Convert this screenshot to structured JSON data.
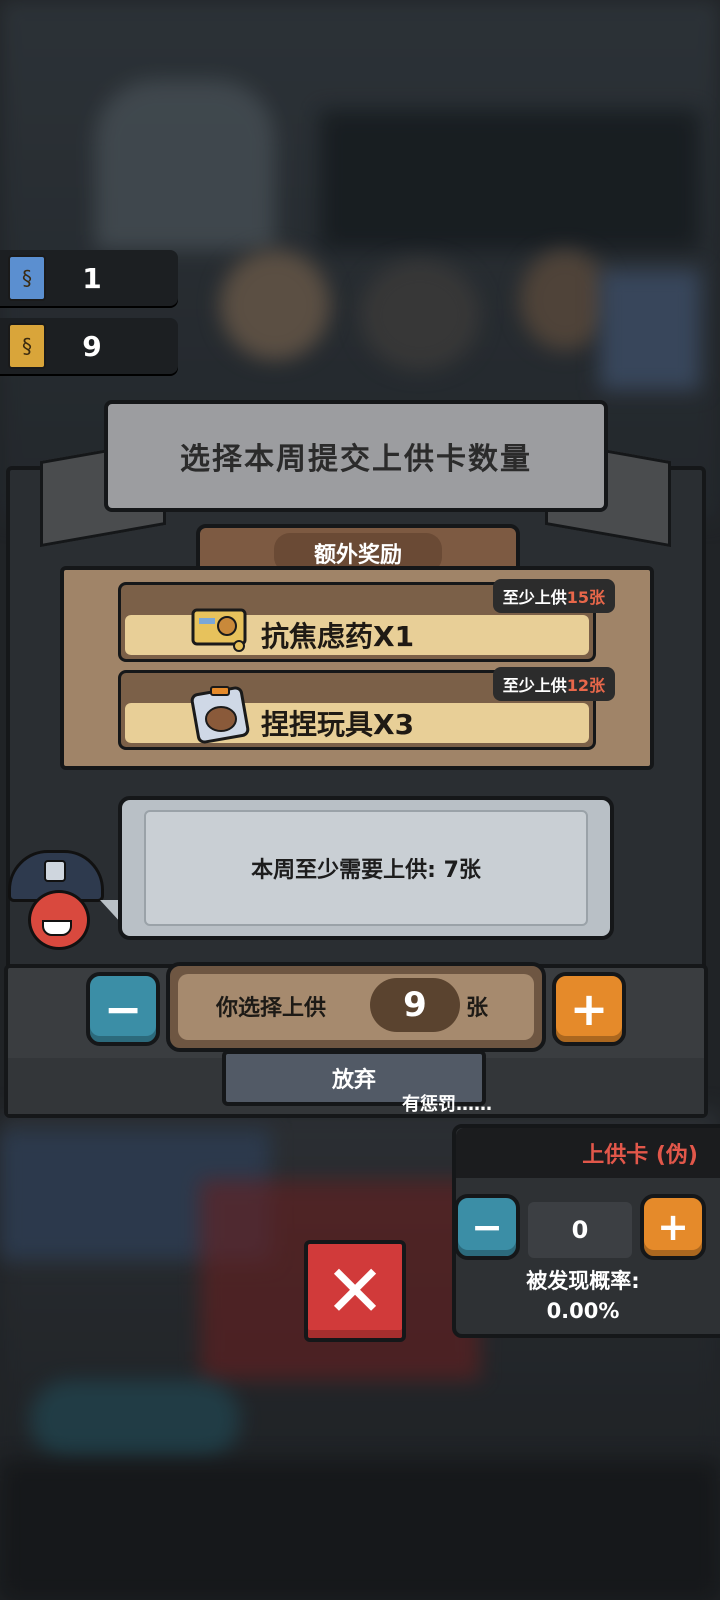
{
  "currency": {
    "real_cards": {
      "value": "1",
      "icon": "blue-card-icon",
      "color": "#5b8fd0"
    },
    "gold_cards": {
      "value": "9",
      "icon": "gold-card-icon",
      "color": "#d9a53a"
    }
  },
  "dialog": {
    "title": "选择本周提交上供卡数量",
    "rewards_title": "额外奖励",
    "rewards": [
      {
        "name": "抗焦虑药X1",
        "icon": "medicine-pack-icon",
        "requirement_prefix": "至少上供",
        "requirement_count": "15张"
      },
      {
        "name": "捏捏玩具X3",
        "icon": "squeeze-toy-icon",
        "requirement_prefix": "至少上供",
        "requirement_count": "12张"
      }
    ],
    "speech": "本周至少需要上供: 7张",
    "selector": {
      "prefix": "你选择上供",
      "value": "9",
      "suffix": "张",
      "minus": "−",
      "plus": "+"
    },
    "give_up": {
      "label": "放弃",
      "note": "有惩罚……"
    }
  },
  "fake_card": {
    "title": "上供卡 (伪)",
    "value": "0",
    "minus": "−",
    "plus": "+",
    "probability_label": "被发现概率:",
    "probability_value": "0.00%"
  },
  "close": {
    "icon": "close-x-icon",
    "glyph": "✕"
  },
  "colors": {
    "accent_red": "#e2574a",
    "blue_button": "#3b8ea6",
    "orange_button": "#e58a2a",
    "close_red": "#d13a3a"
  }
}
